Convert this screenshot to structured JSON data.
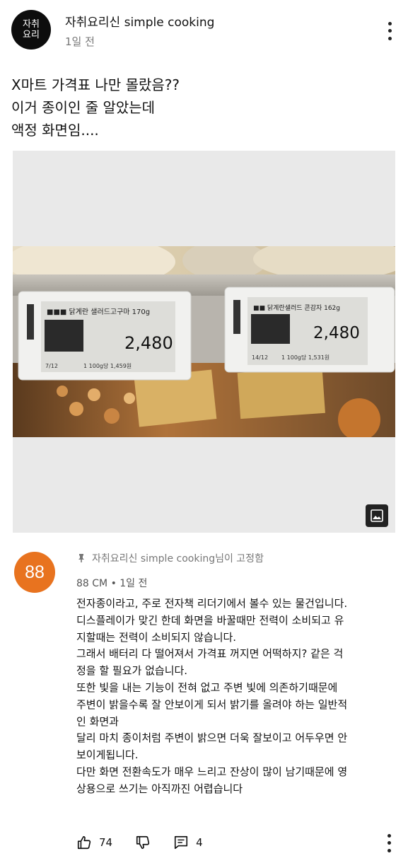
{
  "post": {
    "avatar_text": [
      "자취",
      "요리"
    ],
    "channel_name": "자취요리신 simple cooking",
    "time": "1일 전",
    "text_lines": [
      "X마트 가격표 나만 몰랐음??",
      "이거 종이인 줄 알았는데",
      "액정 화면임...."
    ],
    "photo_labels": {
      "left_price": "2,480",
      "right_price": "2,480",
      "left_name": "■■■ 닭계란 샐러드고구마 170g",
      "right_name": "■■ 닭계란샐러드 콘감자 162g",
      "left_unit": "1 100g당 1,459원",
      "right_unit": "1 100g당 1,531원",
      "left_date": "7/12",
      "right_date": "14/12"
    }
  },
  "comment": {
    "avatar_text": "88",
    "pinned_text": "자취요리신 simple cooking님이 고정함",
    "meta": "88 CM • 1일 전",
    "body_lines": [
      "전자종이라고, 주로 전자책 리더기에서 볼수 있는 물건입니다.",
      "디스플레이가 맞긴 한데 화면을 바꿀때만 전력이 소비되고 유",
      "지할때는 전력이 소비되지 않습니다.",
      "그래서 배터리 다 떨어져서 가격표 꺼지면 어떡하지? 같은 걱",
      "정을 할 필요가 없습니다.",
      "또한 빛을 내는 기능이 전혀 없고 주변 빛에 의존하기때문에",
      "주변이 밝을수록 잘 안보이게 되서 밝기를 올려야 하는 일반적",
      "인 화면과",
      "달리 마치 종이처럼 주변이 밝으면 더욱 잘보이고 어두우면 안",
      "보이게됩니다.",
      "다만 화면 전환속도가 매우 느리고 잔상이 많이 남기때문에 영",
      "상용으로 쓰기는 아직까진 어렵습니다"
    ],
    "like_count": "74",
    "reply_count": "4"
  },
  "icons": {
    "post_menu": "more-vertical-icon",
    "image": "image-icon",
    "pin": "pin-icon",
    "like": "thumbs-up-icon",
    "dislike": "thumbs-down-icon",
    "reply": "comment-icon",
    "comment_menu": "more-vertical-icon"
  },
  "colors": {
    "comment_avatar": "#e8731f",
    "channel_avatar": "#0d0d0d",
    "muted_text": "#777777"
  }
}
